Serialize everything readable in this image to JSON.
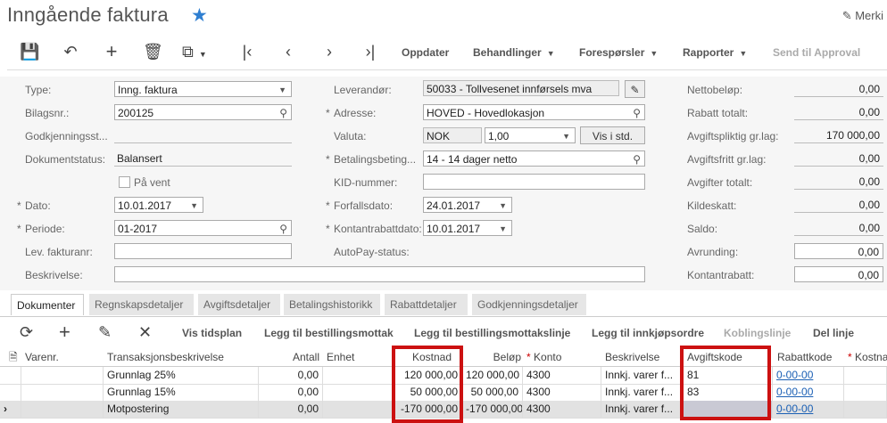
{
  "page": {
    "title": "Inngående faktura",
    "merk_label": "Merki"
  },
  "toolbar": {
    "oppdater": "Oppdater",
    "behandlinger": "Behandlinger",
    "foresporsler": "Forespørsler",
    "rapporter": "Rapporter",
    "send_approval": "Send til Approval"
  },
  "form": {
    "type_label": "Type:",
    "type_value": "Inng. faktura",
    "bilagsnr_label": "Bilagsnr.:",
    "bilagsnr_value": "200125",
    "godkj_label": "Godkjenningsst...",
    "dokstatus_label": "Dokumentstatus:",
    "dokstatus_value": "Balansert",
    "pa_vent_label": "På vent",
    "dato_label": "Dato:",
    "dato_value": "10.01.2017",
    "periode_label": "Periode:",
    "periode_value": "01-2017",
    "levfaktura_label": "Lev. fakturanr:",
    "beskrivelse_label": "Beskrivelse:",
    "leverandor_label": "Leverandør:",
    "leverandor_value": "50033 - Tollvesenet innførsels mva",
    "adresse_label": "Adresse:",
    "adresse_value": "HOVED - Hovedlokasjon",
    "valuta_label": "Valuta:",
    "valuta_value": "NOK",
    "kurs_value": "1,00",
    "vis_std": "Vis i std.",
    "betaling_label": "Betalingsbeting...",
    "betaling_value": "14 - 14 dager netto",
    "kid_label": "KID-nummer:",
    "forfall_label": "Forfallsdato:",
    "forfall_value": "24.01.2017",
    "kontant_label": "Kontantrabattdato:",
    "kontant_value": "10.01.2017",
    "autopay_label": "AutoPay-status:",
    "netto_label": "Nettobeløp:",
    "netto_value": "0,00",
    "rabatt_label": "Rabatt totalt:",
    "rabatt_value": "0,00",
    "avgpl_label": "Avgiftspliktig gr.lag:",
    "avgpl_value": "170 000,00",
    "avgfri_label": "Avgiftsfritt gr.lag:",
    "avgfri_value": "0,00",
    "avgtot_label": "Avgifter totalt:",
    "avgtot_value": "0,00",
    "kilde_label": "Kildeskatt:",
    "kilde_value": "0,00",
    "saldo_label": "Saldo:",
    "saldo_value": "0,00",
    "avrund_label": "Avrunding:",
    "avrund_value": "0,00",
    "kontrab_label": "Kontantrabatt:",
    "kontrab_value": "0,00"
  },
  "tabs": [
    "Dokumenter",
    "Regnskapsdetaljer",
    "Avgiftsdetaljer",
    "Betalingshistorikk",
    "Rabattdetaljer",
    "Godkjenningsdetaljer"
  ],
  "gridbar": {
    "vis_tidsplan": "Vis tidsplan",
    "legg_bestilling": "Legg til bestillingsmottak",
    "legg_bestillingslinje": "Legg til bestillingsmottakslinje",
    "legg_innkjop": "Legg til innkjøpsordre",
    "koblingslinje": "Koblingslinje",
    "del_linje": "Del linje"
  },
  "grid": {
    "headers": {
      "varenr": "Varenr.",
      "trans": "Transaksjonsbeskrivelse",
      "antall": "Antall",
      "enhet": "Enhet",
      "kostnad": "Kostnad",
      "belop": "Beløp",
      "konto": "Konto",
      "beskr": "Beskrivelse",
      "avgkode": "Avgiftskode",
      "rabattkode": "Rabattkode",
      "kostnadss": "Kostna"
    },
    "rows": [
      {
        "trans": "Grunnlag 25%",
        "antall": "0,00",
        "kostnad": "120 000,00",
        "belop": "120 000,00",
        "konto": "4300",
        "beskr": "Innkj. varer f...",
        "avgkode": "81",
        "rabattkode": "0-00-00"
      },
      {
        "trans": "Grunnlag 15%",
        "antall": "0,00",
        "kostnad": "50 000,00",
        "belop": "50 000,00",
        "konto": "4300",
        "beskr": "Innkj. varer f...",
        "avgkode": "83",
        "rabattkode": "0-00-00"
      },
      {
        "trans": "Motpostering",
        "antall": "0,00",
        "kostnad": "-170 000,00",
        "belop": "-170 000,00",
        "konto": "4300",
        "beskr": "Innkj. varer f...",
        "avgkode": "",
        "rabattkode": "0-00-00"
      }
    ]
  }
}
